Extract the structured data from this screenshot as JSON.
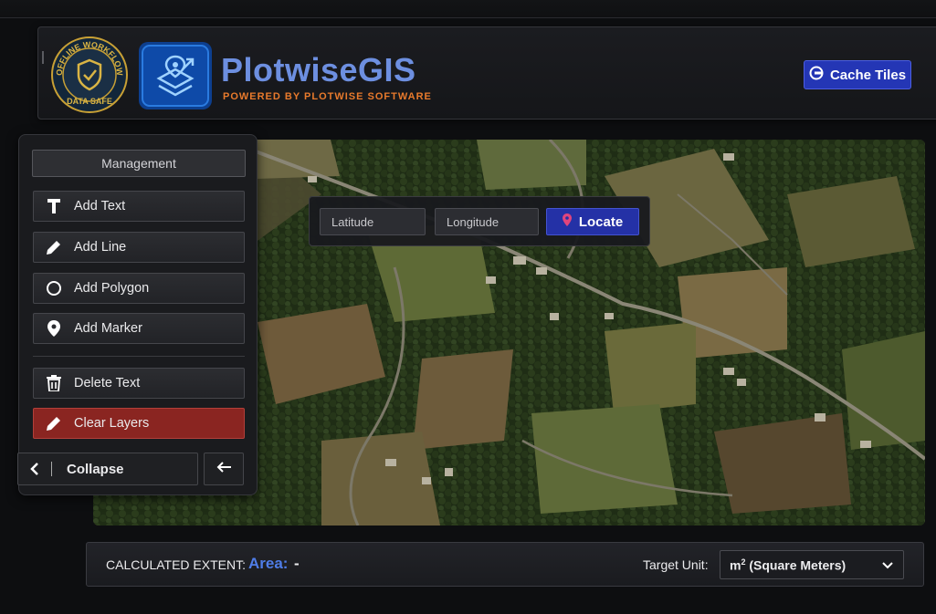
{
  "header": {
    "badge_text_top": "OFFLINE WORKFLOW",
    "badge_text_bottom": "DATA SAFE",
    "app_title": "PlotwiseGIS",
    "app_subtitle": "POWERED BY PLOTWISE SOFTWARE",
    "cache_button": "Cache Tiles"
  },
  "locate": {
    "latitude_placeholder": "Latitude",
    "longitude_placeholder": "Longitude",
    "latitude_value": "",
    "longitude_value": "",
    "locate_button": "Locate"
  },
  "sidebar": {
    "section_title": "Management",
    "tools": [
      {
        "label": "Add Text",
        "icon": "text-icon"
      },
      {
        "label": "Add Line",
        "icon": "pencil-icon"
      },
      {
        "label": "Add Polygon",
        "icon": "circle-icon"
      },
      {
        "label": "Add Marker",
        "icon": "marker-icon"
      }
    ],
    "actions": [
      {
        "label": "Delete Text",
        "icon": "trash-icon"
      },
      {
        "label": "Clear Layers",
        "icon": "eraser-icon"
      }
    ],
    "collapse_label": "Collapse"
  },
  "footer": {
    "extent_label": "CALCULATED EXTENT:",
    "area_label": "Area:",
    "area_value": "-",
    "unit_label": "Target Unit:",
    "unit_selected_sup": "2",
    "unit_selected_rest": " (Square Meters)",
    "unit_selected_prefix": "m"
  },
  "colors": {
    "accent_blue": "#2431a6",
    "danger_red": "#8a2521",
    "title_blue": "#6d8fe0",
    "subtitle_orange": "#e87a2c",
    "area_blue": "#4f7de8"
  }
}
